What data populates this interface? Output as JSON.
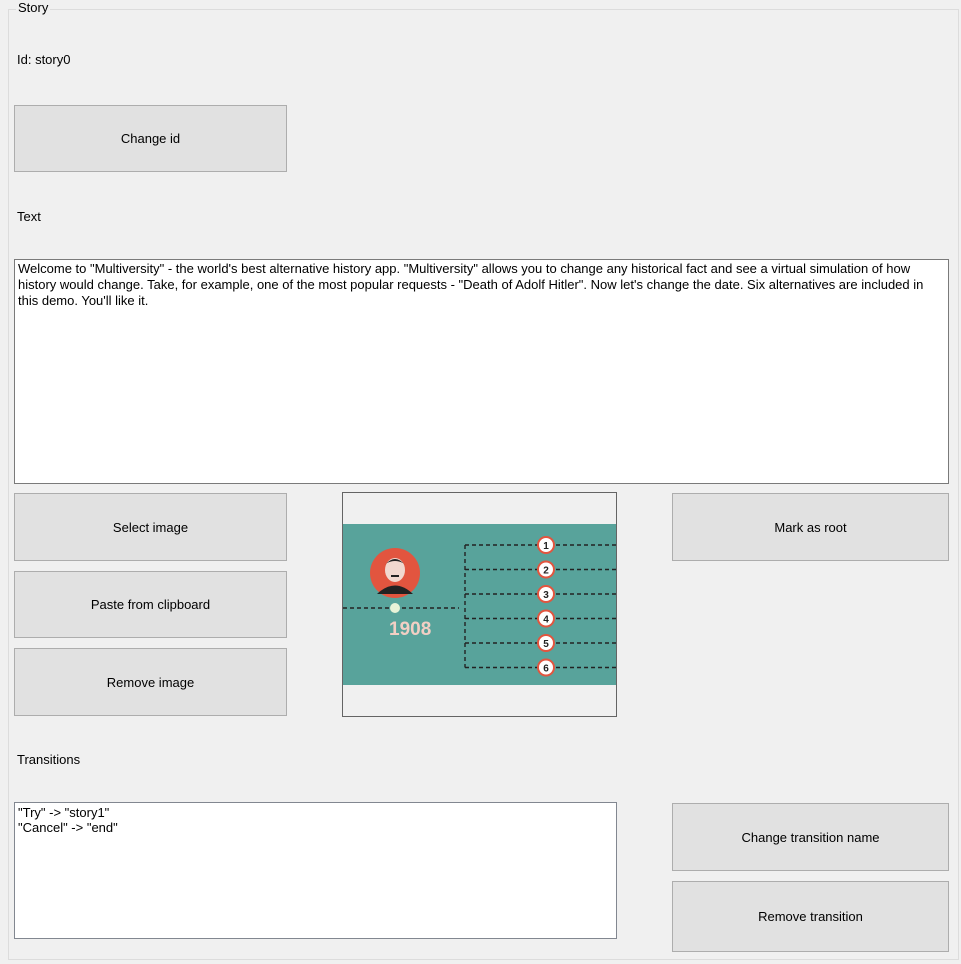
{
  "group": {
    "title": "Story"
  },
  "story": {
    "id_label": "Id: story0",
    "change_id_label": "Change id"
  },
  "text_section": {
    "label": "Text",
    "value": "Welcome to \"Multiversity\" - the world's best alternative history app. \"Multiversity\" allows you to change any historical fact and see a virtual simulation of how history would change. Take, for example, one of the most popular requests - \"Death of Adolf Hitler\". Now let's change the date. Six alternatives are included in this demo. You'll like it."
  },
  "image_section": {
    "select_label": "Select image",
    "paste_label": "Paste from clipboard",
    "remove_label": "Remove image",
    "mark_root_label": "Mark as root",
    "preview": {
      "year": "1908",
      "branches": [
        "1",
        "2",
        "3",
        "4",
        "5",
        "6"
      ],
      "colors": {
        "band": "#58a39b",
        "portrait": "#e2553f",
        "year": "#f2cfc4"
      }
    }
  },
  "transitions": {
    "label": "Transitions",
    "items": [
      "\"Try\" -> \"story1\"",
      "\"Cancel\" -> \"end\""
    ],
    "change_name_label": "Change transition name",
    "remove_label": "Remove transition"
  }
}
